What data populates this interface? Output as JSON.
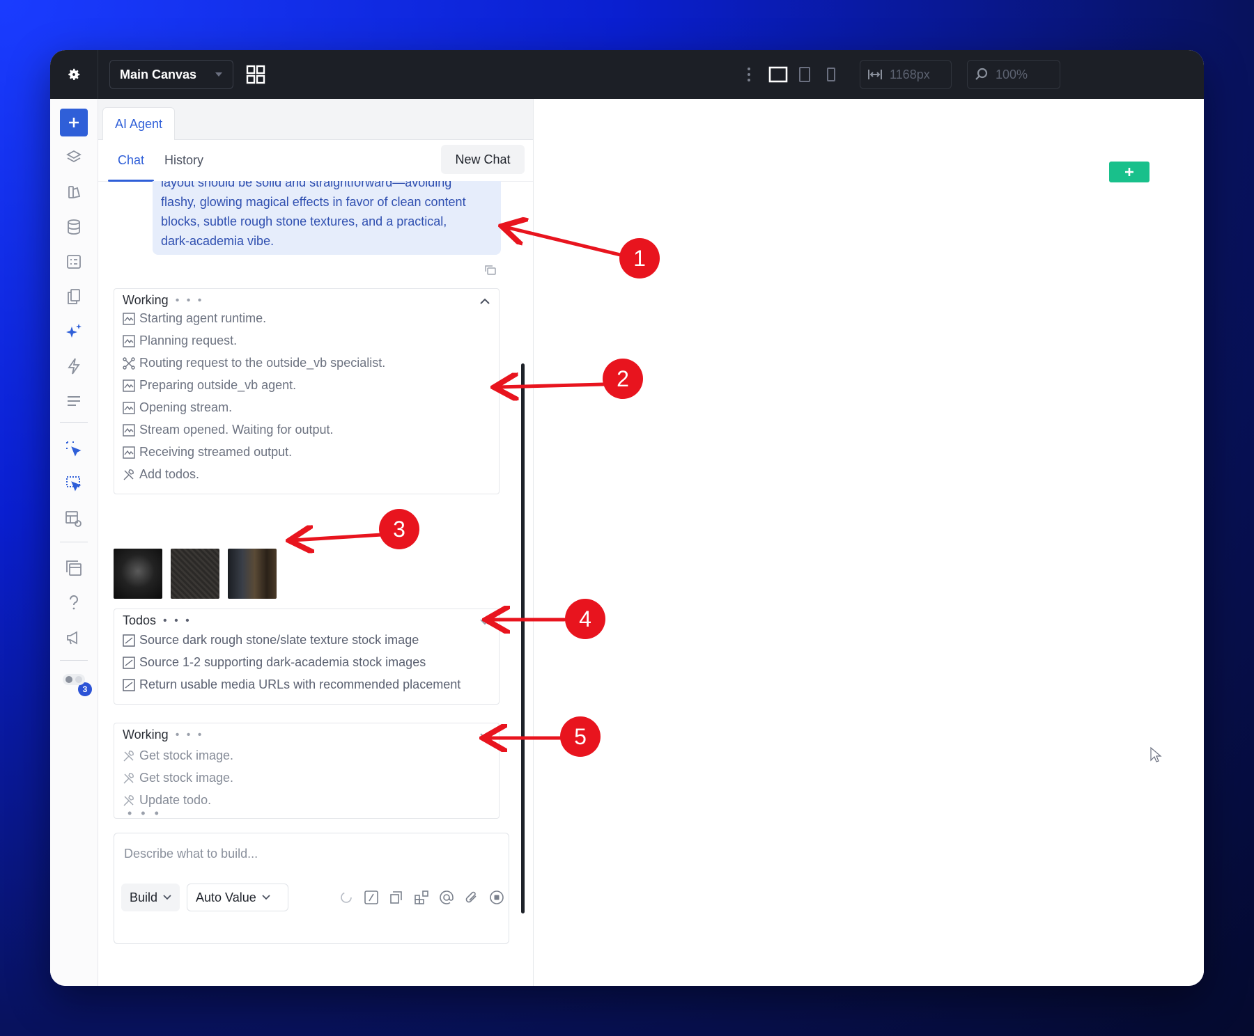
{
  "topbar": {
    "canvas_name": "Main Canvas",
    "width_value": "1168px",
    "zoom_value": "100%"
  },
  "panel": {
    "agent_tab": "AI Agent",
    "tabs": {
      "chat": "Chat",
      "history": "History"
    },
    "new_chat": "New Chat"
  },
  "user_message": {
    "lines": [
      "layout should be solid and straightforward—avoiding",
      "flashy, glowing magical effects in favor of clean content",
      "blocks, subtle rough stone textures, and a practical,",
      "dark-academia vibe."
    ]
  },
  "working1": {
    "title": "Working",
    "dots": "• • •",
    "steps": [
      "Starting agent runtime.",
      "Planning request.",
      "Routing request to the outside_vb specialist.",
      "Preparing outside_vb agent.",
      "Opening stream.",
      "Stream opened. Waiting for output.",
      "Receiving streamed output.",
      "Add todos."
    ]
  },
  "todos": {
    "title": "Todos",
    "dots": "• • •",
    "items": [
      "Source dark rough stone/slate texture stock image",
      "Source 1-2 supporting dark-academia stock images",
      "Return usable media URLs with recommended placement"
    ]
  },
  "working2": {
    "title": "Working",
    "dots": "• • •",
    "steps": [
      "Get stock image.",
      "Get stock image.",
      "Update todo."
    ]
  },
  "typing_dots": "• • •",
  "composer": {
    "placeholder": "Describe what to build...",
    "mode": "Build",
    "value_mode": "Auto Value"
  },
  "rail": {
    "notification_count": "3"
  },
  "annotations": [
    "1",
    "2",
    "3",
    "4",
    "5"
  ],
  "colors": {
    "accent": "#2f5fd8",
    "annotation_red": "#e8141e",
    "add_button_green": "#19c08b",
    "topbar": "#1c1f26"
  },
  "icons": {
    "topbar": [
      "gear-icon",
      "grid-icon",
      "more-vertical-icon",
      "desktop-icon",
      "tablet-icon",
      "mobile-icon",
      "width-icon",
      "zoom-icon"
    ],
    "rail": [
      "plus-icon",
      "layers-icon",
      "assets-icon",
      "database-icon",
      "forms-icon",
      "pages-icon",
      "ai-sparkle-icon",
      "lightning-icon",
      "list-icon",
      "select-icon",
      "multi-select-icon",
      "preview-icon",
      "components-icon",
      "help-icon",
      "announcement-icon",
      "theme-toggle-icon"
    ]
  }
}
